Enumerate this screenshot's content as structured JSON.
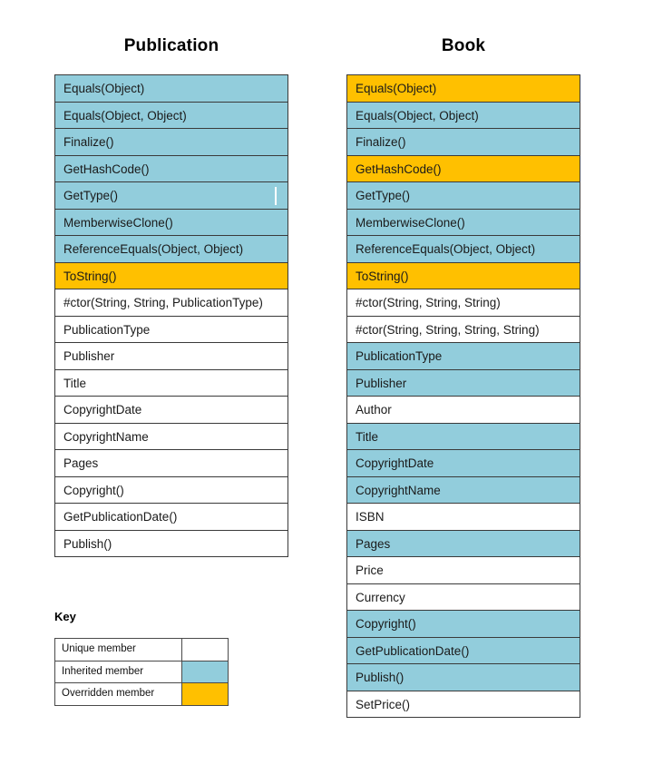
{
  "diagram": {
    "legend_colors": {
      "unique": "#FFFFFF",
      "inherited": "#92CDDC",
      "overridden": "#FFC000",
      "border": "#3A3A3A"
    },
    "columns": [
      {
        "title": "Publication",
        "members": [
          {
            "label": "Equals(Object)",
            "kind": "inherited"
          },
          {
            "label": "Equals(Object, Object)",
            "kind": "inherited"
          },
          {
            "label": "Finalize()",
            "kind": "inherited"
          },
          {
            "label": "GetHashCode()",
            "kind": "inherited"
          },
          {
            "label": "GetType()",
            "kind": "inherited"
          },
          {
            "label": "MemberwiseClone()",
            "kind": "inherited"
          },
          {
            "label": "ReferenceEquals(Object,  Object)",
            "kind": "inherited"
          },
          {
            "label": "ToString()",
            "kind": "overridden"
          },
          {
            "label": "#ctor(String,  String,  PublicationType)",
            "kind": "unique"
          },
          {
            "label": "PublicationType",
            "kind": "unique"
          },
          {
            "label": "Publisher",
            "kind": "unique"
          },
          {
            "label": "Title",
            "kind": "unique"
          },
          {
            "label": "CopyrightDate",
            "kind": "unique"
          },
          {
            "label": "CopyrightName",
            "kind": "unique"
          },
          {
            "label": "Pages",
            "kind": "unique"
          },
          {
            "label": "Copyright()",
            "kind": "unique"
          },
          {
            "label": "GetPublicationDate()",
            "kind": "unique"
          },
          {
            "label": "Publish()",
            "kind": "unique"
          }
        ]
      },
      {
        "title": "Book",
        "members": [
          {
            "label": "Equals(Object)",
            "kind": "overridden"
          },
          {
            "label": "Equals(Object, Object)",
            "kind": "inherited"
          },
          {
            "label": "Finalize()",
            "kind": "inherited"
          },
          {
            "label": "GetHashCode()",
            "kind": "overridden"
          },
          {
            "label": "GetType()",
            "kind": "inherited"
          },
          {
            "label": "MemberwiseClone()",
            "kind": "inherited"
          },
          {
            "label": "ReferenceEquals(Object,  Object)",
            "kind": "inherited"
          },
          {
            "label": "ToString()",
            "kind": "overridden"
          },
          {
            "label": "#ctor(String,  String,  String)",
            "kind": "unique"
          },
          {
            "label": "#ctor(String,  String,  String,  String)",
            "kind": "unique"
          },
          {
            "label": "PublicationType",
            "kind": "inherited"
          },
          {
            "label": "Publisher",
            "kind": "inherited"
          },
          {
            "label": "Author",
            "kind": "unique"
          },
          {
            "label": "Title",
            "kind": "inherited"
          },
          {
            "label": "CopyrightDate",
            "kind": "inherited"
          },
          {
            "label": "CopyrightName",
            "kind": "inherited"
          },
          {
            "label": "ISBN",
            "kind": "unique"
          },
          {
            "label": "Pages",
            "kind": "inherited"
          },
          {
            "label": "Price",
            "kind": "unique"
          },
          {
            "label": "Currency",
            "kind": "unique"
          },
          {
            "label": "Copyright()",
            "kind": "inherited"
          },
          {
            "label": "GetPublicationDate()",
            "kind": "inherited"
          },
          {
            "label": "Publish()",
            "kind": "inherited"
          },
          {
            "label": "SetPrice()",
            "kind": "unique"
          }
        ]
      }
    ]
  },
  "key": {
    "title": "Key",
    "rows": [
      {
        "label": "Unique member",
        "kind": "unique"
      },
      {
        "label": "Inherited  member",
        "kind": "inherited"
      },
      {
        "label": "Overridden  member",
        "kind": "overridden"
      }
    ]
  }
}
